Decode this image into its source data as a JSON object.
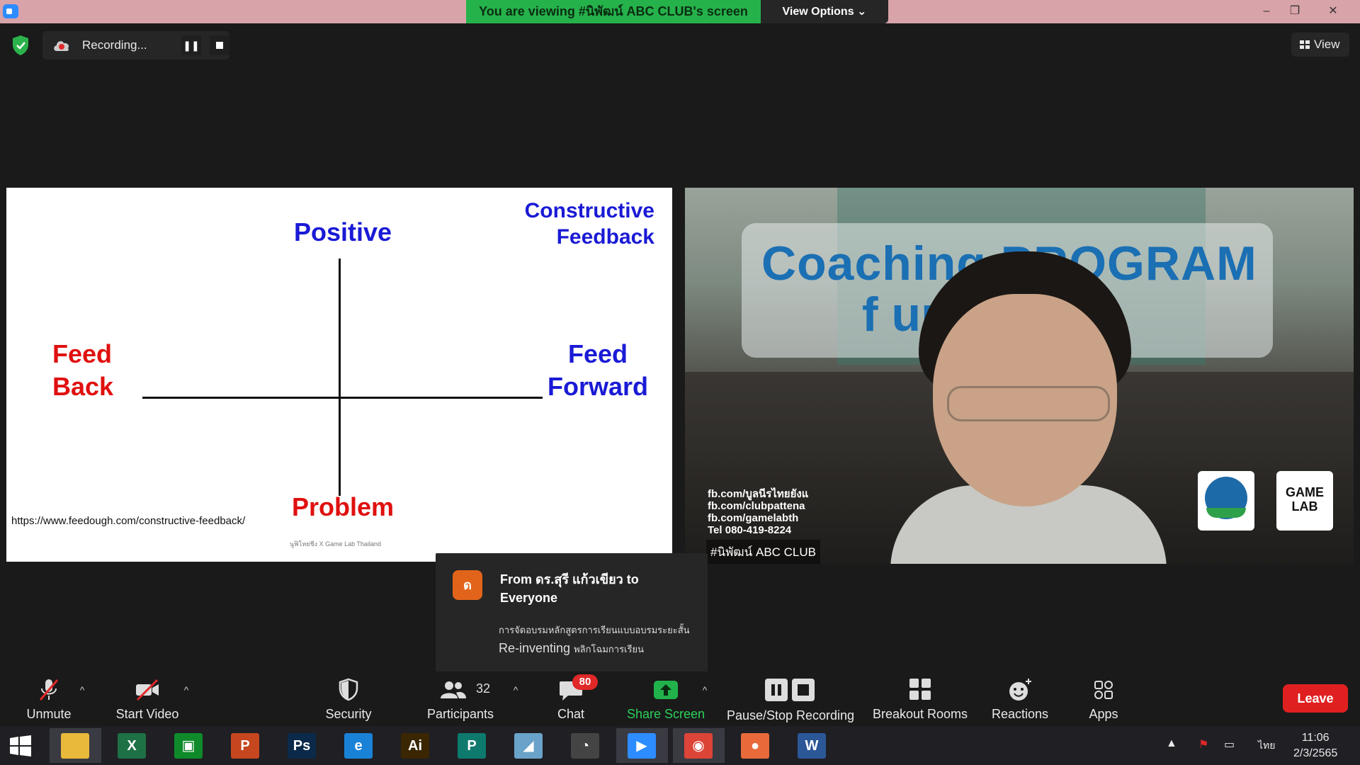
{
  "titlebar": {
    "banner": "You are viewing #นิพัฒน์ ABC CLUB's screen",
    "view_options": "View Options",
    "minimize": "–",
    "restore": "❐",
    "close": "✕"
  },
  "recording": {
    "label": "Recording...",
    "pause_glyph": "❚❚"
  },
  "view_button": "View",
  "slide": {
    "positive": "Positive",
    "constructive": "Constructive Feedback",
    "feedback": "Feed Back",
    "feedforward": "Feed Forward",
    "problem": "Problem",
    "url": "https://www.feedough.com/constructive-feedback/",
    "credit": "นูฟิโหย่ชีง X Game Lab Thailand"
  },
  "video": {
    "title_line1": "Coaching PROGRAM",
    "title_line2": "f    urer",
    "info": [
      "fb.com/บูลนีรไทยยังแ",
      "fb.com/clubpattena",
      "fb.com/gamelabth",
      "Tel 080-419-8224"
    ],
    "logo_text": "GAME LAB",
    "name": "#นิพัฒน์ ABC CLUB"
  },
  "chat": {
    "avatar": "ด",
    "from": "From ดร.สุรี  แก้วเขียว to Everyone",
    "line1": "การจัดอบรมหลักสูตรการเรียนแบบอบรมระยะสั้น",
    "line2_main": "Re-inventing",
    "line2_suffix": "พลิกโฉมการเรียน"
  },
  "toolbar": {
    "unmute": "Unmute",
    "start_video": "Start Video",
    "security": "Security",
    "participants": "Participants",
    "participants_count": "32",
    "chat": "Chat",
    "chat_badge": "80",
    "share_screen": "Share Screen",
    "pause_stop_recording": "Pause/Stop Recording",
    "breakout_rooms": "Breakout Rooms",
    "reactions": "Reactions",
    "apps": "Apps",
    "leave": "Leave",
    "caret": "^"
  },
  "taskbar": {
    "apps": [
      {
        "name": "file-explorer",
        "glyph": "",
        "color": "#e8b93a"
      },
      {
        "name": "excel",
        "glyph": "X",
        "color": "#1e7145"
      },
      {
        "name": "store",
        "glyph": "▣",
        "color": "#0f8a2a"
      },
      {
        "name": "powerpoint",
        "glyph": "P",
        "color": "#c5461f"
      },
      {
        "name": "photoshop",
        "glyph": "Ps",
        "color": "#0b2a4a"
      },
      {
        "name": "internet-explorer",
        "glyph": "e",
        "color": "#1a82d6"
      },
      {
        "name": "illustrator",
        "glyph": "Ai",
        "color": "#3a2600"
      },
      {
        "name": "publisher",
        "glyph": "P",
        "color": "#0e7a6e"
      },
      {
        "name": "notes",
        "glyph": "◢",
        "color": "#6aa3c9"
      },
      {
        "name": "photoscape",
        "glyph": "◔",
        "color": "#444"
      },
      {
        "name": "zoom",
        "glyph": "▶",
        "color": "#2d8cff"
      },
      {
        "name": "chrome",
        "glyph": "◉",
        "color": "#db4437"
      },
      {
        "name": "presentation",
        "glyph": "●",
        "color": "#e86a3a"
      },
      {
        "name": "word",
        "glyph": "W",
        "color": "#2b5797"
      }
    ],
    "language": "ไทย",
    "time": "11:06",
    "date": "2/3/2565",
    "tray_up": "▲",
    "flag": "⚑",
    "network": "▭"
  }
}
